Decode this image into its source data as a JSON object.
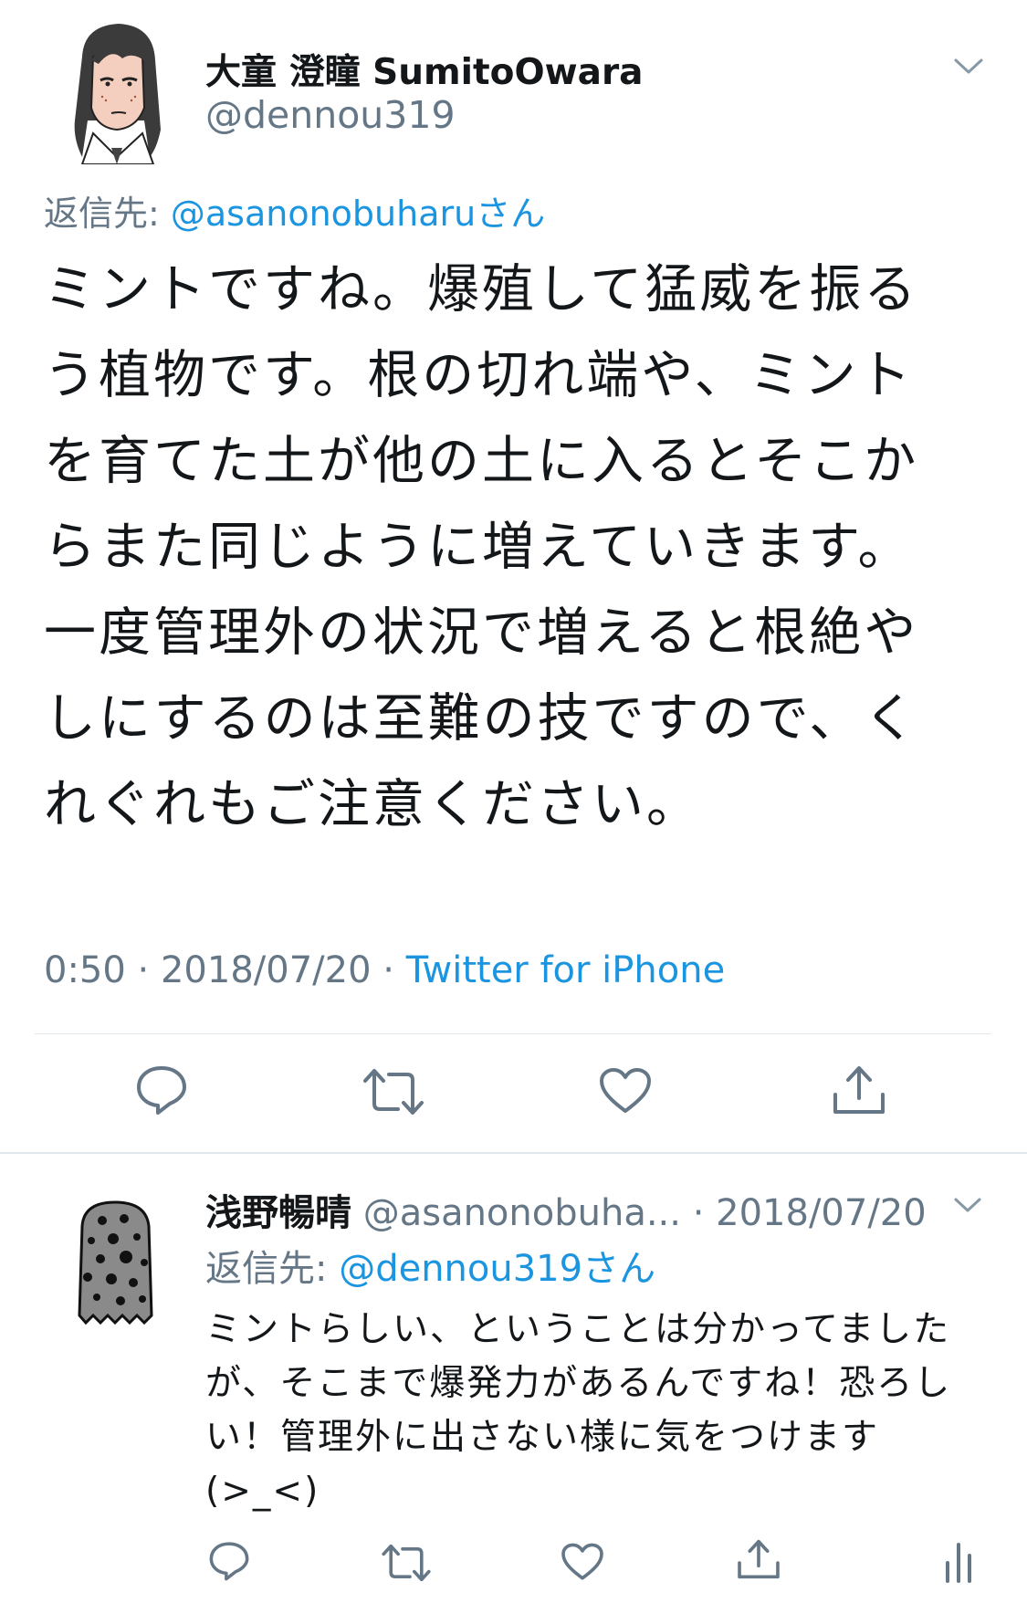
{
  "main_tweet": {
    "display_name": "大童 澄瞳 SumitoOwara",
    "handle": "@dennou319",
    "reply_prefix": "返信先: ",
    "reply_to": "@asanonobuharuさん",
    "text": "ミントですね。爆殖して猛威を振る\nう植物です。根の切れ端や、ミント\nを育てた土が他の土に入るとそこか\nらまた同じように増えていきます。\n一度管理外の状況で増えると根絶や\nしにするのは至難の技ですので、く\nれぐれもご注意ください。",
    "time": "0:50",
    "date": "2018/07/20",
    "separator": " · ",
    "source": "Twitter for iPhone",
    "actions": {
      "reply_icon": "reply-icon",
      "retweet_icon": "retweet-icon",
      "like_icon": "heart-icon",
      "share_icon": "share-icon"
    }
  },
  "reply_tweet": {
    "display_name": "浅野暢晴",
    "handle": "@asanonobuha...",
    "separator": " · ",
    "date": "2018/07/20",
    "reply_prefix": "返信先: ",
    "reply_to": "@dennou319さん",
    "text": "ミントらしい、ということは分かってました\nが、そこまで爆発力があるんですね！恐ろし\nい！管理外に出さない様に気をつけます\n(>_<)",
    "actions": {
      "reply_icon": "reply-icon",
      "retweet_icon": "retweet-icon",
      "like_icon": "heart-icon",
      "share_icon": "share-icon",
      "analytics_icon": "analytics-icon"
    }
  },
  "colors": {
    "text": "#14171a",
    "muted": "#657786",
    "link": "#1b95e0",
    "divider": "#e1e8ed"
  }
}
